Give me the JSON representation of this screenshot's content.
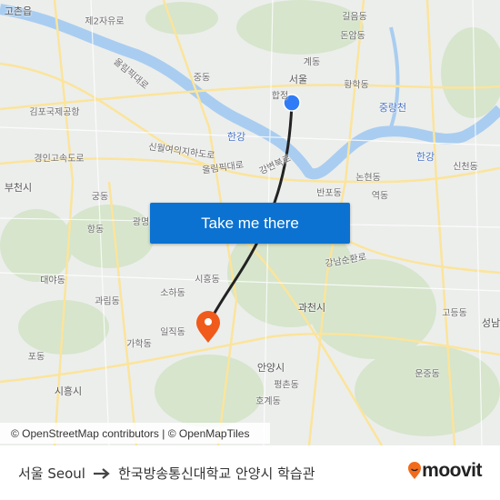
{
  "map": {
    "labels": [
      "고촌읍",
      "제2자유로",
      "길음동",
      "돈암동",
      "중동",
      "서울",
      "계동",
      "황학동",
      "올림픽대로",
      "김포국제공항",
      "중랑천",
      "한강",
      "신월여의지하도로",
      "경인고속도로",
      "한강",
      "신천동",
      "논현동",
      "부천시",
      "올림픽대로",
      "반포동",
      "역동",
      "궁동",
      "광명",
      "항동",
      "강남순환로",
      "대야동",
      "시흥동",
      "과림동",
      "소하동",
      "과천시",
      "고등동",
      "성남",
      "일직동",
      "가학동",
      "포동",
      "안양시",
      "운중동",
      "시흥시",
      "평촌동",
      "호계동",
      "강변북로",
      "합정"
    ],
    "origin_marker": {
      "icon": "origin-dot-icon",
      "color": "#2f7cf6"
    },
    "destination_marker": {
      "icon": "map-pin-icon",
      "color": "#f05a1a"
    },
    "route_color": "#222222",
    "attribution": "© OpenStreetMap contributors | © OpenMapTiles"
  },
  "cta": {
    "label": "Take me there",
    "color": "#0b72d1"
  },
  "footer": {
    "origin": "서울 Seoul",
    "arrow_icon": "arrow-right-icon",
    "destination": "한국방송통신대학교 안양시 학습관",
    "logo": "moovit",
    "logo_color": "#f26b1d"
  }
}
